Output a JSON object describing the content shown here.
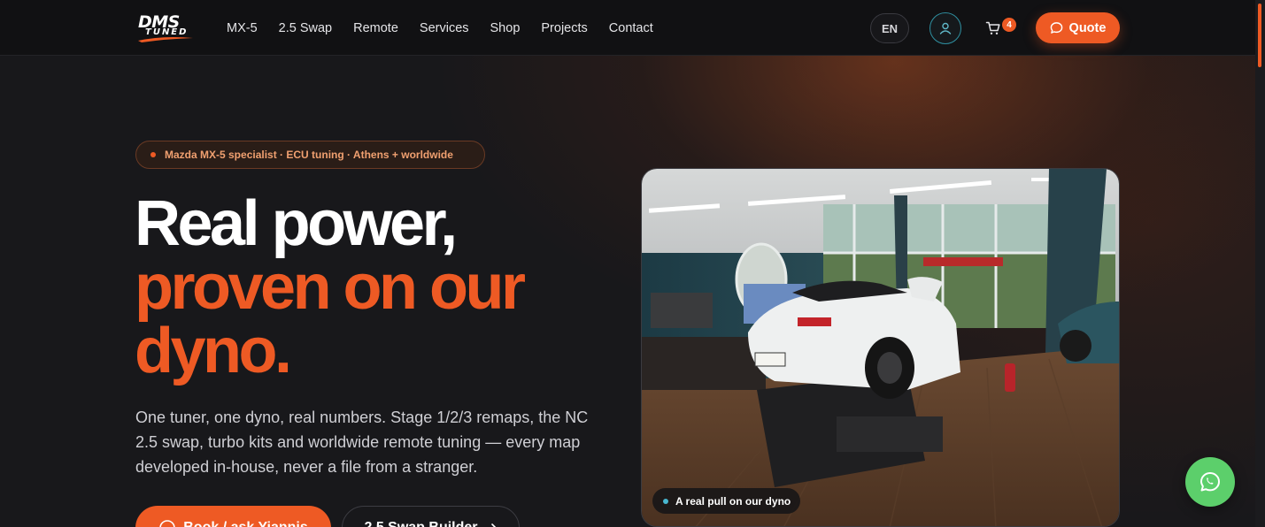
{
  "brand": {
    "logo_main": "DMS",
    "logo_sub": "TUNED"
  },
  "nav": {
    "items": [
      {
        "label": "MX-5"
      },
      {
        "label": "2.5 Swap"
      },
      {
        "label": "Remote"
      },
      {
        "label": "Services"
      },
      {
        "label": "Shop"
      },
      {
        "label": "Projects"
      },
      {
        "label": "Contact"
      }
    ],
    "language": "EN",
    "cart_count": "4",
    "quote_label": "Quote",
    "icons": {
      "account": "user-icon",
      "cart": "cart-icon",
      "quote": "chat-bubble-icon"
    }
  },
  "hero": {
    "tagline": "Mazda MX-5 specialist · ECU tuning · Athens + worldwide",
    "headline_line1": "Real power,",
    "headline_line2": "proven on our dyno.",
    "lede": "One tuner, one dyno, real numbers. Stage 1/2/3 remaps, the NC 2.5 swap, turbo kits and worldwide remote tuning — every map developed in-house, never a file from a stranger.",
    "cta_primary": "Book / ask Yiannis",
    "cta_secondary": "2.5 Swap Builder",
    "photo_caption": "A real pull on our dyno"
  },
  "floating": {
    "whatsapp_icon": "whatsapp-icon"
  },
  "colors": {
    "accent": "#ee5a24",
    "background": "#17171a",
    "whatsapp": "#5ccf6b",
    "caption_dot": "#48b7d0"
  }
}
